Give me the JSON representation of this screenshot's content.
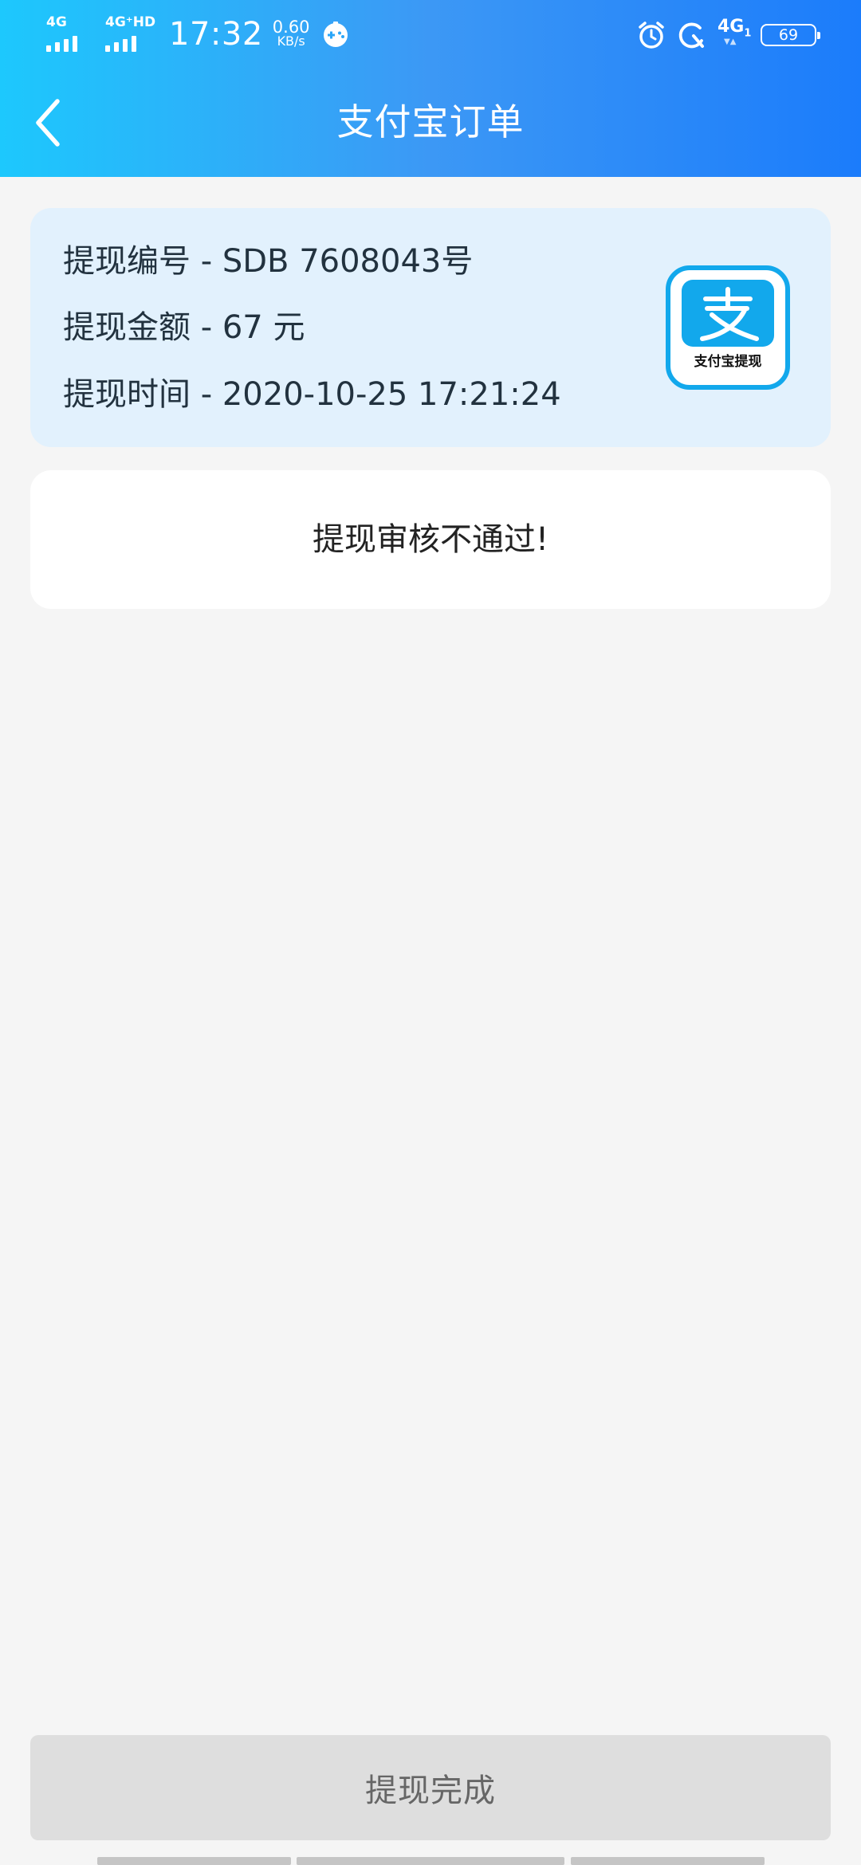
{
  "status_bar": {
    "network_1": "4G",
    "network_2": "4G⁺HD",
    "time": "17:32",
    "speed_value": "0.60",
    "speed_unit": "KB/s",
    "network_3": "4G",
    "network_3_sub": "1",
    "battery": "69"
  },
  "nav": {
    "title": "支付宝订单"
  },
  "order": {
    "number_line": "提现编号 - SDB 7608043号",
    "amount_line": "提现金额 - 67 元",
    "time_line": "提现时间 - 2020-10-25 17:21:24",
    "logo_caption": "支付宝提现"
  },
  "status": {
    "message": "提现审核不通过!"
  },
  "footer": {
    "button_label": "提现完成"
  },
  "colors": {
    "header_start": "#1dc8fd",
    "header_end": "#1b7cfb",
    "alipay_blue": "#12a8ec",
    "card_bg": "#e2f1fd",
    "button_bg": "#dedede"
  }
}
